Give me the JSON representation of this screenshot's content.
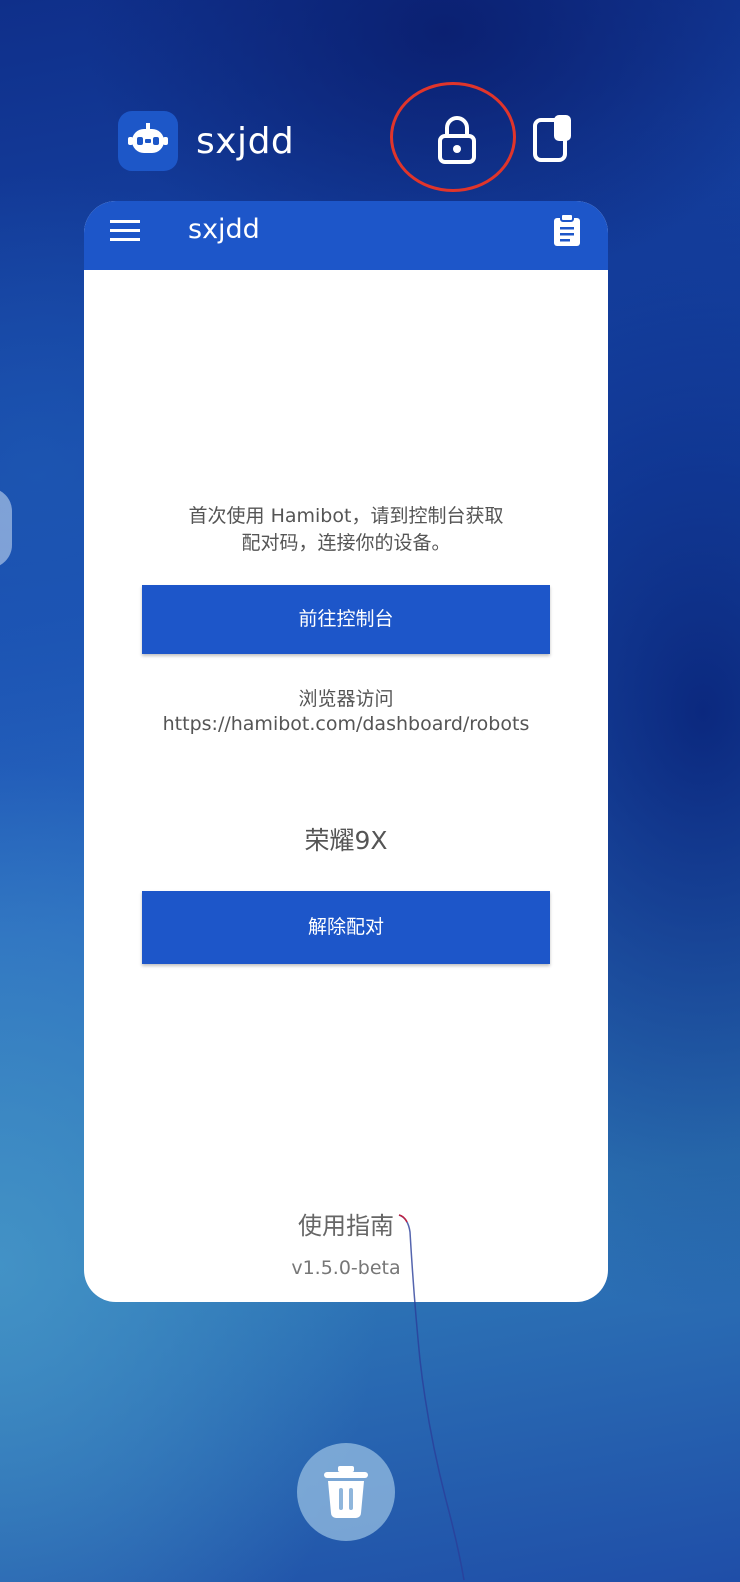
{
  "app_header": {
    "app_name": "sxjdd",
    "icon": "robot-icon",
    "lock_icon": "lock-icon",
    "window_icon": "floating-window-icon"
  },
  "card": {
    "toolbar": {
      "title": "sxjdd",
      "menu_icon": "menu-icon",
      "clipboard_icon": "clipboard-icon"
    },
    "hint_line1": "首次使用 Hamibot，请到控制台获取",
    "hint_line2": "配对码，连接你的设备。",
    "console_button_label": "前往控制台",
    "browser_label": "浏览器访问",
    "browser_url": "https://hamibot.com/dashboard/robots",
    "device_name": "荣耀9X",
    "unpair_button_label": "解除配对",
    "guide_link": "使用指南",
    "version": "v1.5.0-beta"
  },
  "trash_icon": "trash-icon",
  "colors": {
    "accent": "#1d56c9",
    "highlight_circle": "#e0352b"
  }
}
